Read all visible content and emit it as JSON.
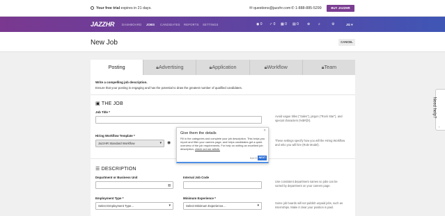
{
  "trial": {
    "bold": "Your free trial",
    "rest": "expires in 21 days."
  },
  "contact": {
    "email": "questions@jazzhr.com",
    "phone": "1-888-885-5299"
  },
  "buy_label": "BUY JAZZHR",
  "nav": {
    "logo": "JAZZHR",
    "items": [
      "DASHBOARD",
      "JOBS",
      "CANDIDATES",
      "REPORTS",
      "SETTINGS"
    ],
    "active": "JOBS",
    "counts": [
      "0",
      "0",
      "0",
      "0"
    ],
    "user": "JG"
  },
  "page": {
    "title": "New Job",
    "cancel": "CANCEL"
  },
  "tabs": [
    "Posting",
    "Advertising",
    "Application",
    "Workflow",
    "Team"
  ],
  "intro": {
    "title": "Write a compelling job description.",
    "body": "Ensure that your posting is engaging and has the potential to draw the greatest number of qualified candidates."
  },
  "the_job": {
    "heading": "THE JOB",
    "job_title_label": "Job Title *",
    "job_title_help": "Avoid vague titles (\"Sales\"), jargon (\"Rock Star\"), and special characters (%$#@!).",
    "workflow_label": "Hiring Workflow Template *",
    "workflow_value": "JazzHR Standard Workflow",
    "workflow_help": "These settings specify how you will the Hiring Workflow and who you will hire (Role Model)."
  },
  "description": {
    "heading": "DESCRIPTION",
    "dept_label": "Department or Business Unit",
    "code_label": "Internal Job Code",
    "dept_help": "Use consistent department names so jobs can be sorted by department on your careers page.",
    "emp_label": "Employment Type *",
    "emp_value": "Select Employment Type...",
    "exp_label": "Minimum Experience *",
    "exp_value": "Select Minimum Experience...",
    "emp_help": "Some job boards will not publish unpaid jobs, such as Internships. Make it clear your position is paid."
  },
  "tooltip": {
    "title": "Give them the details",
    "body": "Fill in the categories and complete your job description. This helps you report and filter your careers page, and helps candidates get a quick overview of the job requirements. For help on writing an excellent job description,",
    "link": "check out our article.",
    "back": "BACK",
    "next": "NEXT"
  },
  "need_help": "Need help?",
  "colors": {
    "brand_start": "#7a3890",
    "brand_end": "#3f56b5",
    "buy": "#7a3d92",
    "next": "#2d6fd6"
  }
}
